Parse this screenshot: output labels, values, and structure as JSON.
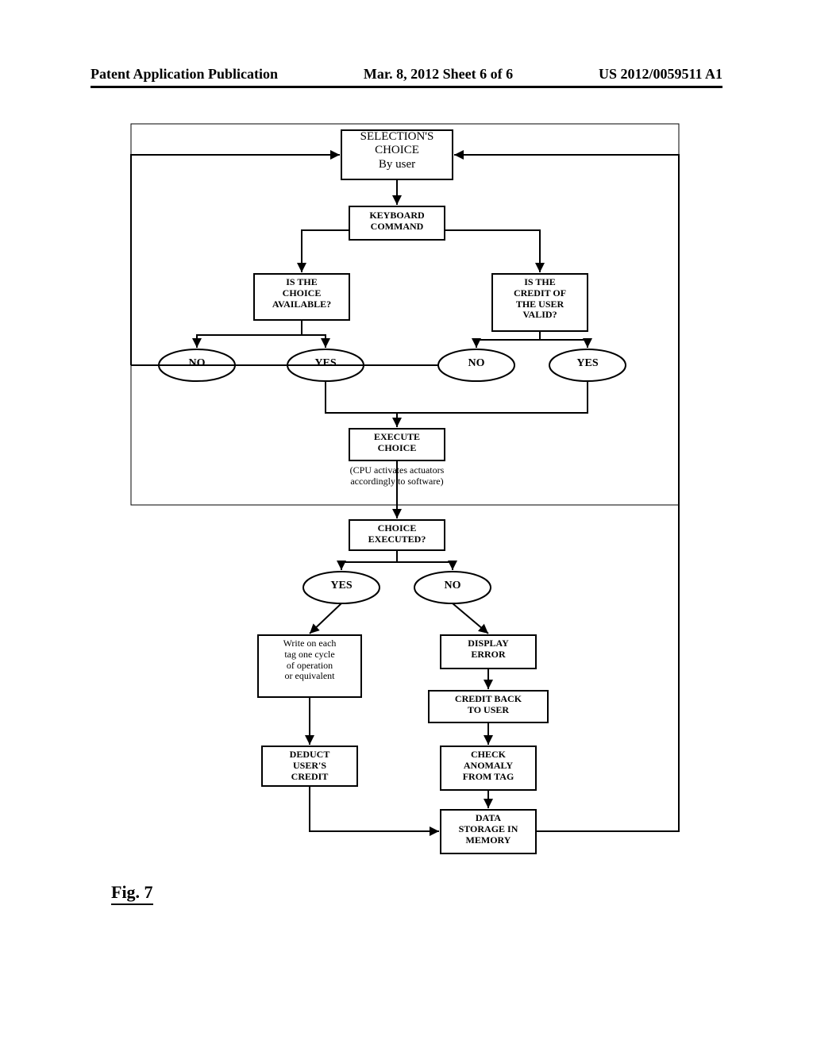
{
  "header": {
    "left": "Patent Application Publication",
    "center": "Mar. 8, 2012  Sheet 6 of 6",
    "right": "US 2012/0059511 A1"
  },
  "figure_label": "Fig. 7",
  "nodes": {
    "selection_choice": {
      "l1": "SELECTION'S",
      "l2": "CHOICE",
      "l3": "By user"
    },
    "keyboard_command": {
      "l1": "KEYBOARD",
      "l2": "COMMAND"
    },
    "choice_available": {
      "l1": "IS THE",
      "l2": "CHOICE",
      "l3": "AVAILABLE?"
    },
    "credit_valid": {
      "l1": "IS THE",
      "l2": "CREDIT OF",
      "l3": "THE USER",
      "l4": "VALID?"
    },
    "no1": "NO",
    "yes1": "YES",
    "no2": "NO",
    "yes2": "YES",
    "execute_choice": {
      "l1": "EXECUTE",
      "l2": "CHOICE"
    },
    "cpu_note": {
      "l1": "(CPU activates actuators",
      "l2": "accordingly to software)"
    },
    "choice_executed": {
      "l1": "CHOICE",
      "l2": "EXECUTED?"
    },
    "yes3": "YES",
    "no3": "NO",
    "write_tag": {
      "l1": "Write on each",
      "l2": "tag one cycle",
      "l3": "of operation",
      "l4": "or equivalent"
    },
    "display_error": {
      "l1": "DISPLAY",
      "l2": "ERROR"
    },
    "credit_back": {
      "l1": "CREDIT BACK",
      "l2": "TO USER"
    },
    "deduct_credit": {
      "l1": "DEDUCT",
      "l2": "USER'S",
      "l3": "CREDIT"
    },
    "check_anomaly": {
      "l1": "CHECK",
      "l2": "ANOMALY",
      "l3": "FROM TAG"
    },
    "data_storage": {
      "l1": "DATA",
      "l2": "STORAGE IN",
      "l3": "MEMORY"
    }
  }
}
